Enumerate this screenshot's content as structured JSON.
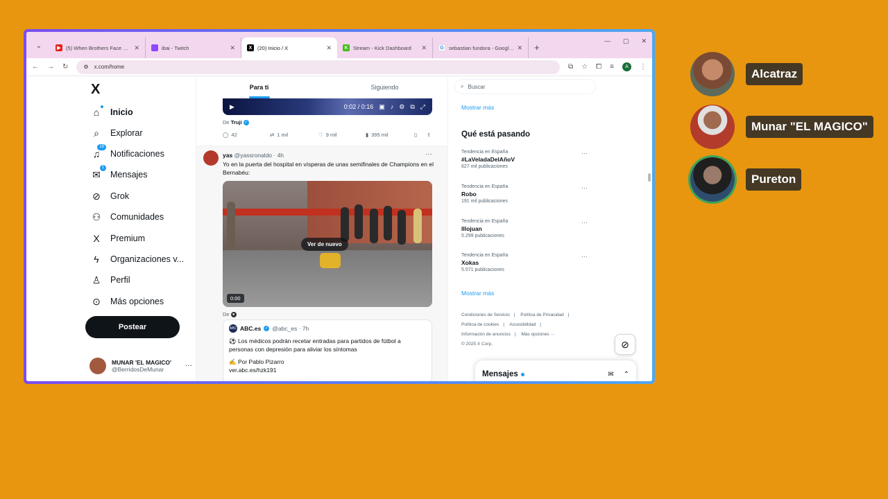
{
  "browser": {
    "tabs": [
      {
        "title": "(5) When Brothers Face Each Ot",
        "fav_color": "#E62117",
        "active": false
      },
      {
        "title": "ibai - Twitch",
        "fav_color": "#9146FF",
        "active": false
      },
      {
        "title": "(20) Inicio / X",
        "fav_color": "#000000",
        "active": true
      },
      {
        "title": "Stream - Kick Dashboard",
        "fav_color": "#53FC18",
        "active": false
      },
      {
        "title": "sebastian fundora - Google Sea",
        "fav_color": "#4285F4",
        "active": false
      }
    ],
    "url": "x.com/home",
    "profile_initial": "A"
  },
  "nav": {
    "logo": "X",
    "items": [
      {
        "label": "Inicio",
        "icon": "home-icon"
      },
      {
        "label": "Explorar",
        "icon": "search-icon"
      },
      {
        "label": "Notificaciones",
        "icon": "bell-icon",
        "badge": "19"
      },
      {
        "label": "Mensajes",
        "icon": "mail-icon",
        "badge": "1"
      },
      {
        "label": "Grok",
        "icon": "grok-icon"
      },
      {
        "label": "Comunidades",
        "icon": "people-icon"
      },
      {
        "label": "Premium",
        "icon": "x-logo-icon"
      },
      {
        "label": "Organizaciones v...",
        "icon": "lightning-icon"
      },
      {
        "label": "Perfil",
        "icon": "person-icon"
      },
      {
        "label": "Más opciones",
        "icon": "more-circle-icon"
      }
    ],
    "post_button": "Postear",
    "account": {
      "name": "MUNAR 'EL MAGICO'",
      "handle": "@BerridosDeMunar"
    }
  },
  "timeline": {
    "tabs": [
      "Para ti",
      "Siguiendo"
    ],
    "video_time": "0:02 / 0:16",
    "tweet1": {
      "from_prefix": "De",
      "from_name": "Truji",
      "replies": "42",
      "reposts": "1 mil",
      "likes": "9 mil",
      "views": "395 mil"
    },
    "tweet2": {
      "name": "yas",
      "handle_time": "@yassronaldo · 4h",
      "text": "Yo en la puerta del hospital en vísperas de unas semifinales de Champions en el Bernabéu:",
      "replay_label": "Ver de nuevo",
      "video_time": "0:00",
      "from_prefix": "De",
      "quote": {
        "avatar_text": "ABC",
        "name": "ABC.es",
        "handle_time": "@abc_es · 7h",
        "line1": "⚽ Los médicos podrán recetar entradas para partidos de fútbol a personas con depresión para aliviar los síntomas",
        "line2": "✍ Por Pablo Pizarro",
        "line3": "ver.abc.es/hzk191"
      }
    }
  },
  "right": {
    "search_placeholder": "Buscar",
    "show_more_top": "Mostrar más",
    "trends_title": "Qué está pasando",
    "trends": [
      {
        "context": "Tendencia en España",
        "name": "#LaVeladaDelAñoV",
        "posts": "627 mil publicaciones"
      },
      {
        "context": "Tendencia en España",
        "name": "Robo",
        "posts": "191 mil publicaciones"
      },
      {
        "context": "Tendencia en España",
        "name": "Illojuan",
        "posts": "5.299 publicaciones"
      },
      {
        "context": "Tendencia en España",
        "name": "Xokas",
        "posts": "5.571 publicaciones"
      }
    ],
    "show_more_bottom": "Mostrar más",
    "footer": {
      "line1": [
        "Condiciones de Servicio",
        "|",
        "Política de Privacidad",
        "|"
      ],
      "line2": [
        "Política de cookies",
        "|",
        "Accesibilidad",
        "|"
      ],
      "line3": [
        "Información de anuncios",
        "|",
        "Más opciones ···"
      ],
      "line4": "© 2025 X Corp."
    },
    "messages_drawer": "Mensajes"
  },
  "voice_overlay": [
    {
      "name": "Alcatraz",
      "talking": false,
      "color": "#7a4a35"
    },
    {
      "name": "Munar \"EL MAGICO\"",
      "talking": false,
      "color": "#b23b2c"
    },
    {
      "name": "Pureton",
      "talking": true,
      "color": "#2e4c6d"
    }
  ],
  "colors": {
    "background": "#E8960F",
    "x_blue": "#1d9bf0",
    "tab_strip": "#F3D7EE"
  }
}
